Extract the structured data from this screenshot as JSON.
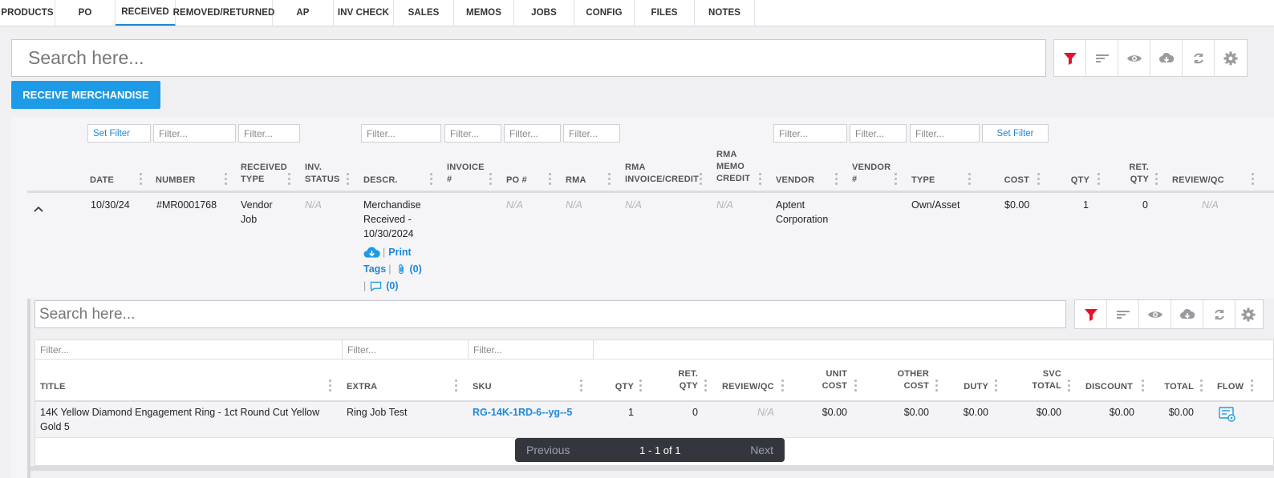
{
  "tabs": [
    "PRODUCTS",
    "PO",
    "RECEIVED",
    "REMOVED/RETURNED",
    "AP",
    "INV CHECK",
    "SALES",
    "MEMOS",
    "JOBS",
    "CONFIG",
    "FILES",
    "NOTES"
  ],
  "search": {
    "placeholder": "Search here..."
  },
  "receive_button": "RECEIVE MERCHANDISE",
  "filters": {
    "set_filter": "Set Filter",
    "placeholder": "Filter..."
  },
  "columns": {
    "date": "DATE",
    "number": "NUMBER",
    "received_type_1": "RECEIVED",
    "received_type_2": "TYPE",
    "inv_status_1": "INV.",
    "inv_status_2": "STATUS",
    "descr": "DESCR.",
    "invoice_1": "INVOICE",
    "invoice_2": "#",
    "po": "PO #",
    "rma": "RMA",
    "rma_invoice_1": "RMA",
    "rma_invoice_2": "INVOICE/CREDIT",
    "rma_memo_1": "RMA",
    "rma_memo_2": "MEMO",
    "rma_memo_3": "CREDIT",
    "vendor": "VENDOR",
    "vendor_no_1": "VENDOR",
    "vendor_no_2": "#",
    "type": "TYPE",
    "cost": "COST",
    "qty": "QTY",
    "ret_qty_1": "RET.",
    "ret_qty_2": "QTY",
    "review": "REVIEW/QC"
  },
  "row": {
    "date": "10/30/24",
    "number": "#MR0001768",
    "received_type_1": "Vendor",
    "received_type_2": "Job",
    "inv_status": "N/A",
    "descr_1": "Merchandise",
    "descr_2": "Received -",
    "descr_3": "10/30/2024",
    "print": "Print",
    "tags": "Tags",
    "attach_count": "(0)",
    "comment_count": "(0)",
    "po": "N/A",
    "rma": "N/A",
    "rma_invoice": "N/A",
    "rma_memo": "N/A",
    "vendor_1": "Aptent",
    "vendor_2": "Corporation",
    "type": "Own/Asset",
    "cost": "$0.00",
    "qty": "1",
    "ret_qty": "0",
    "review": "N/A"
  },
  "sub_columns": {
    "title": "TITLE",
    "extra": "EXTRA",
    "sku": "SKU",
    "qty": "QTY",
    "ret_qty_1": "RET.",
    "ret_qty_2": "QTY",
    "review": "REVIEW/QC",
    "unit_cost_1": "UNIT",
    "unit_cost_2": "COST",
    "other_cost_1": "OTHER",
    "other_cost_2": "COST",
    "duty": "DUTY",
    "svc_total_1": "SVC",
    "svc_total_2": "TOTAL",
    "discount": "DISCOUNT",
    "total": "TOTAL",
    "flow": "FLOW"
  },
  "sub_row": {
    "title_1": "14K Yellow Diamond Engagement Ring - 1ct Round Cut Yellow",
    "title_2": "Gold 5",
    "extra": "Ring Job Test",
    "sku": "RG-14K-1RD-6--yg--5",
    "qty": "1",
    "ret_qty": "0",
    "review": "N/A",
    "unit_cost": "$0.00",
    "other_cost": "$0.00",
    "duty": "$0.00",
    "svc_total": "$0.00",
    "discount": "$0.00",
    "total": "$0.00"
  },
  "pager": {
    "previous": "Previous",
    "status": "1 - 1 of 1",
    "next": "Next"
  },
  "colors": {
    "accent": "#1e9be6",
    "filter_icon": "#e8112d",
    "link": "#1e88d8"
  }
}
